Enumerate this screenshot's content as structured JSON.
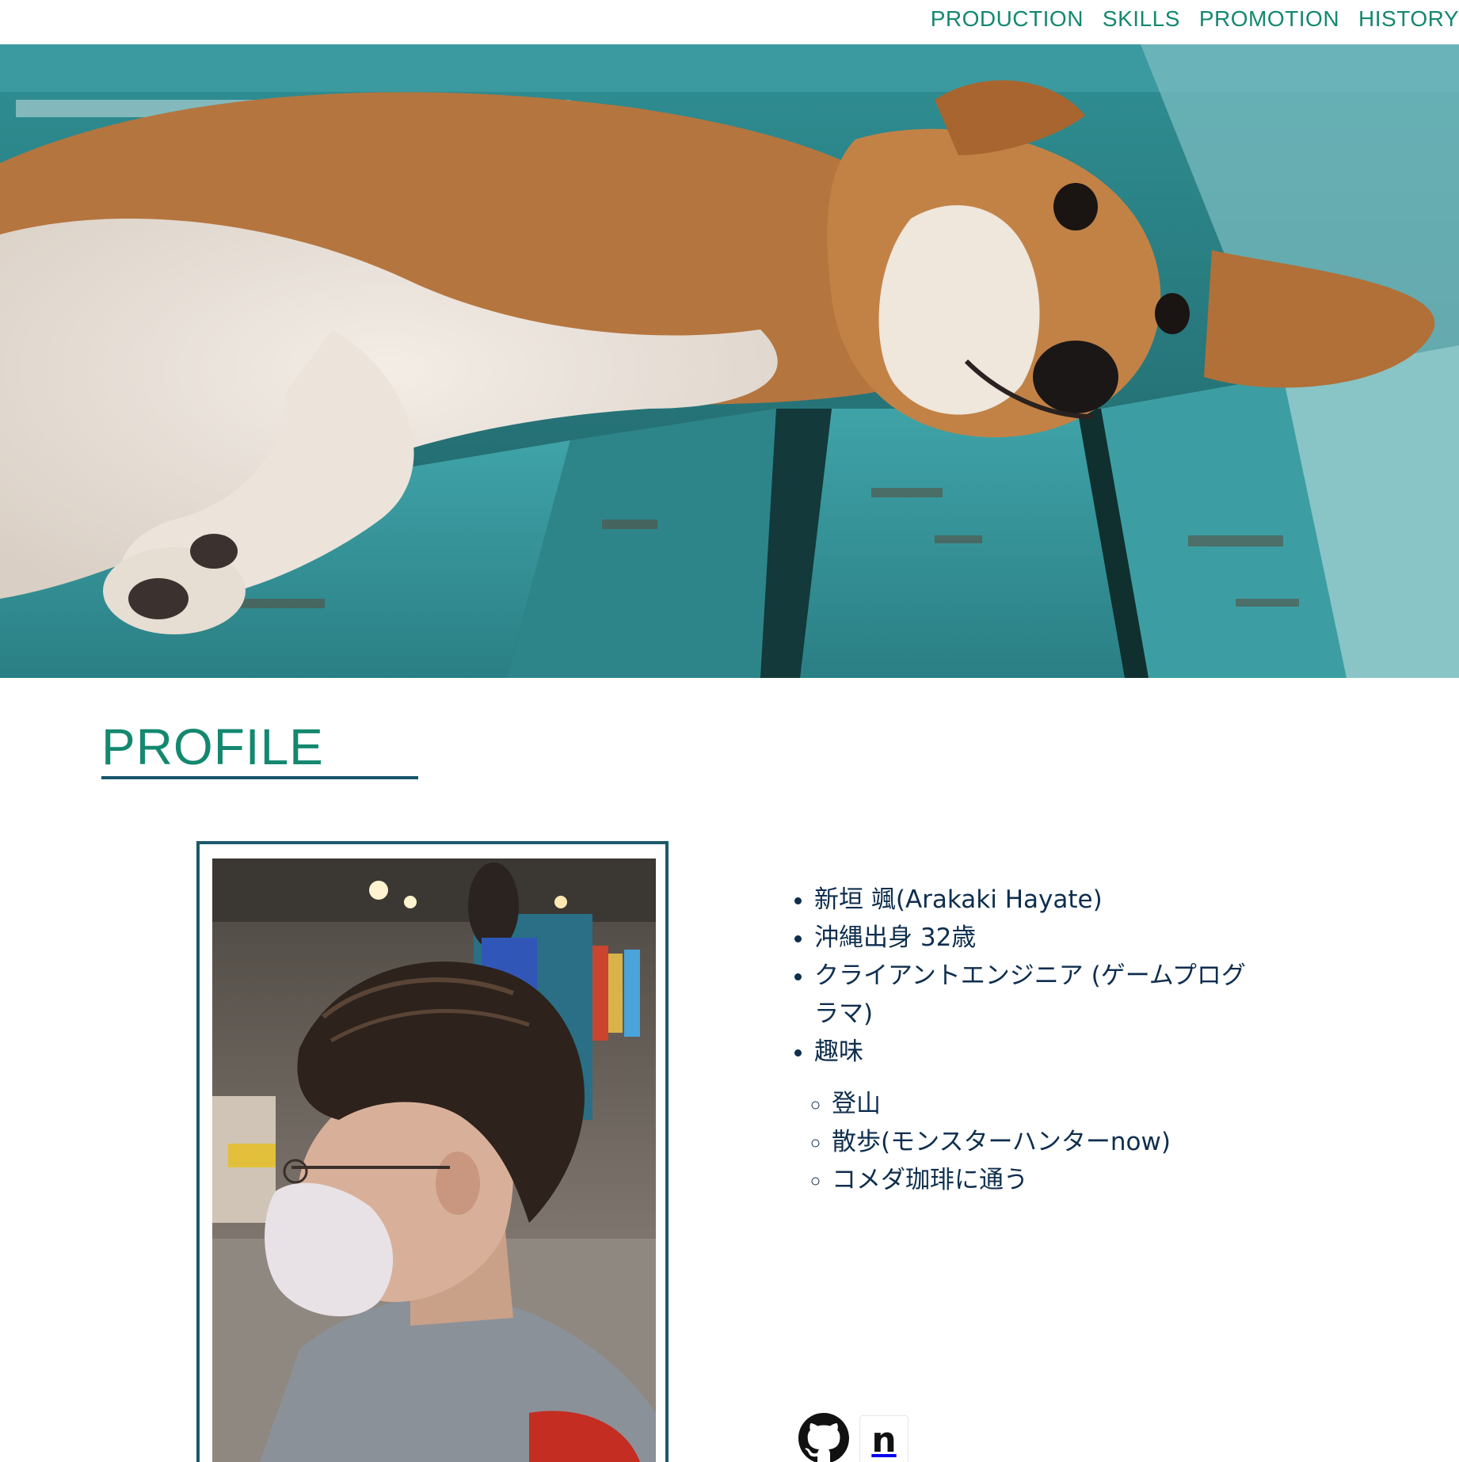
{
  "nav": {
    "items": [
      {
        "label": "PRODUCTION"
      },
      {
        "label": "SKILLS"
      },
      {
        "label": "PROMOTION"
      },
      {
        "label": "HISTORY"
      }
    ],
    "color": "#14886f"
  },
  "hero": {
    "image": "photo of a dog lying on a teal wooden bench"
  },
  "profile": {
    "title": "PROFILE",
    "photo": "photo of a man with glasses and mask in a hair salon",
    "items": [
      "新垣 颯(Arakaki Hayate)",
      "沖縄出身 32歳",
      "クライアントエンジニア (ゲームプログラマ)",
      "趣味"
    ],
    "hobbies": [
      "登山",
      "散歩(モンスターハンターnow)",
      "コメダ珈琲に通う"
    ]
  },
  "social": {
    "note_letter": "n",
    "icons": [
      "github-icon",
      "note-icon"
    ]
  },
  "colors": {
    "accent": "#14886f",
    "frame": "#1b5a6b",
    "text": "#0e2e4e"
  }
}
